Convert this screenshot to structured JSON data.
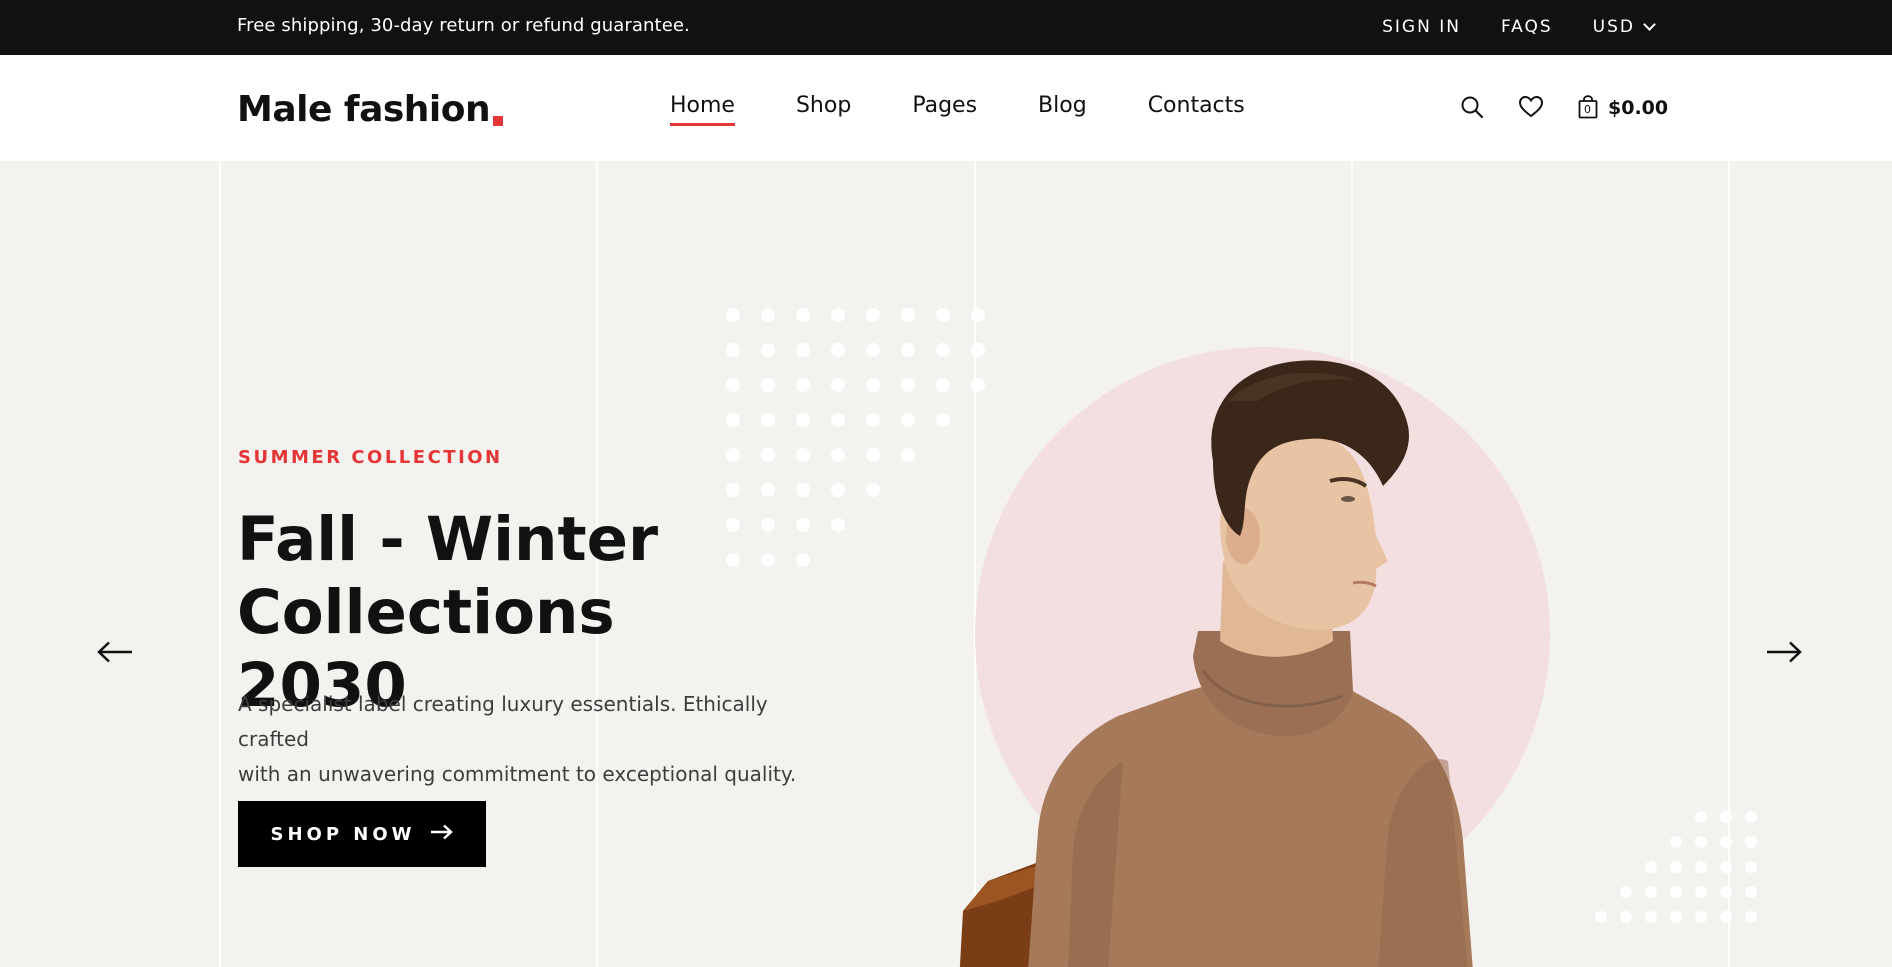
{
  "topbar": {
    "shipping_text": "Free shipping, 30-day return or refund guarantee.",
    "sign_in": "SIGN IN",
    "faqs": "FAQS",
    "currency": "USD"
  },
  "header": {
    "logo_text": "Male fashion",
    "nav": [
      "Home",
      "Shop",
      "Pages",
      "Blog",
      "Contacts"
    ],
    "active_nav": "Home",
    "cart_count": "0",
    "cart_total": "$0.00"
  },
  "hero": {
    "subtitle": "SUMMER COLLECTION",
    "title_line1": "Fall - Winter",
    "title_line2": "Collections 2030",
    "description_line1": "A specialist label creating luxury essentials. Ethically crafted",
    "description_line2": "with an unwavering commitment to exceptional quality.",
    "button_label": "SHOP NOW"
  },
  "colors": {
    "accent": "#e53637",
    "topbar_bg": "#111111",
    "hero_bg": "#f3f2ee",
    "circle": "#f3dfe0",
    "sweater": "#a6795a"
  },
  "icons": [
    "search-icon",
    "heart-icon",
    "shopping-bag-icon",
    "arrow-left-icon",
    "arrow-right-icon",
    "arrow-right-icon"
  ]
}
